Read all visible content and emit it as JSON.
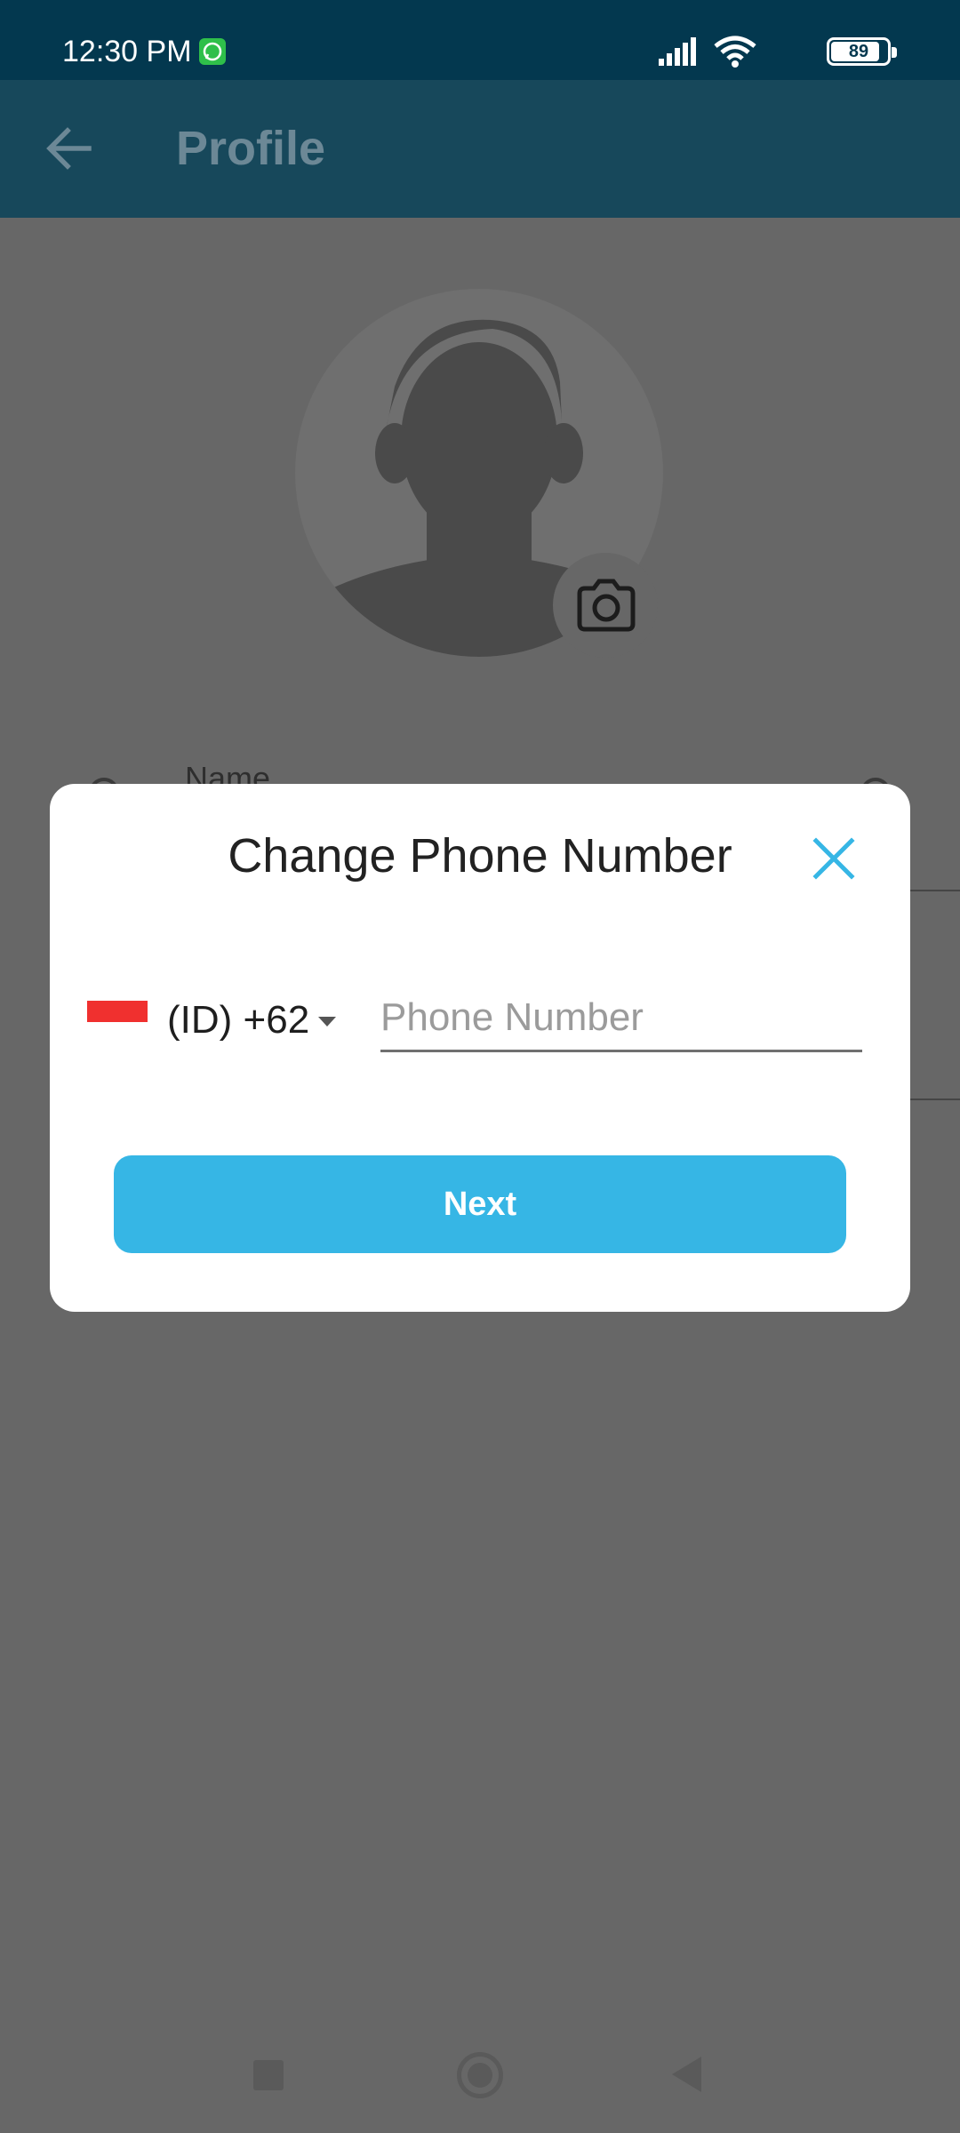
{
  "status_bar": {
    "time": "12:30 PM",
    "battery": "89",
    "icons": [
      "whatsapp-icon",
      "signal-icon",
      "wifi-icon",
      "battery-icon"
    ]
  },
  "app_bar": {
    "title": "Profile",
    "back_icon": "arrow-left-icon"
  },
  "profile": {
    "name_label": "Name"
  },
  "dialog": {
    "title": "Change Phone Number",
    "country_code": "(ID) +62",
    "phone_placeholder": "Phone Number",
    "phone_value": "",
    "next_label": "Next",
    "accent_color": "#36b6e5"
  },
  "nav_bar": {
    "icons": [
      "recents-square-icon",
      "home-circle-icon",
      "back-triangle-icon"
    ]
  }
}
